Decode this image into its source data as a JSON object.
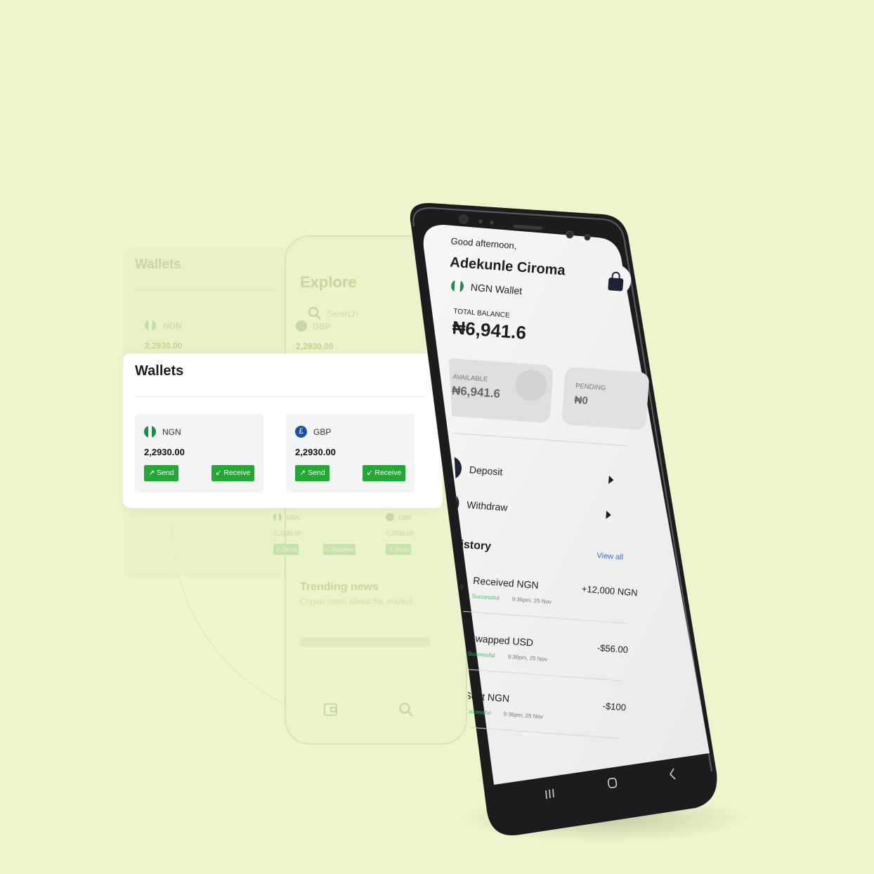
{
  "back_wallets": {
    "title": "Wallets",
    "currency": "NGN",
    "amount": "2,2930.00"
  },
  "back_explore": {
    "title": "Explore",
    "search_placeholder": "Search",
    "currency": "GBP",
    "amount": "2,2930.00",
    "row2_left_currency": "NGN",
    "row2_left_amount": "2,2930.00",
    "row2_right_currency": "GBP",
    "row2_right_amount": "2,2930.00",
    "send_label": "↗ Send",
    "receive_label": "↙ Receive",
    "trending_title": "Trending news",
    "trending_subtitle": "Crypto news about the market"
  },
  "wallets_card": {
    "title": "Wallets",
    "wallets": [
      {
        "currency": "NGN",
        "amount": "2,2930.00",
        "send": "↗ Send",
        "receive": "↙ Receive",
        "icon": "nigeria-flag-icon"
      },
      {
        "currency": "GBP",
        "amount": "2,2930.00",
        "send": "↗ Send",
        "receive": "↙ Receive",
        "icon": "pound-icon",
        "symbol": "£"
      }
    ],
    "accent": "#27a638"
  },
  "phone": {
    "greeting": "Good afternoon,",
    "user_name": "Adekunle Ciroma",
    "wallet_name": "NGN Wallet",
    "total_label": "TOTAL BALANCE",
    "total_value": "₦6,941.6",
    "available_label": "AVAILABLE",
    "available_value": "₦6,941.6",
    "pending_label": "PENDING",
    "pending_value": "₦0",
    "actions": [
      {
        "label": "Deposit",
        "icon": "arrow-down-icon"
      },
      {
        "label": "Withdraw",
        "icon": "arrow-up-icon"
      }
    ],
    "history_title": "All History",
    "view_all": "View all",
    "transactions": [
      {
        "title": "Received NGN",
        "status": "Successful",
        "time": "9:36pm, 25 Nov",
        "amount": "+12,000 NGN",
        "icon": "nigeria-flag-icon"
      },
      {
        "title": "Swapped USD",
        "status": "Successful",
        "time": "9:36pm, 25 Nov",
        "amount": "-$56.00",
        "icon": "us-flag-icon"
      },
      {
        "title": "Sent NGN",
        "status": "Successful",
        "time": "9:36pm, 25 Nov",
        "amount": "-$100",
        "icon": "nigeria-flag-icon"
      }
    ],
    "accent": "#2f6fd0",
    "success_color": "#4bb86a",
    "nav_icons": [
      "recent-apps-icon",
      "home-icon",
      "back-icon"
    ]
  }
}
